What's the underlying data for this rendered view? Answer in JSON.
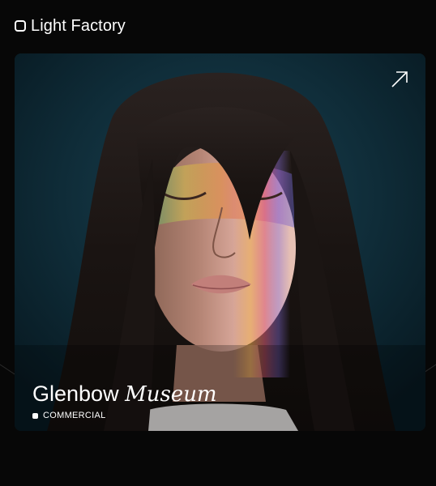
{
  "header": {
    "brand": "Light Factory",
    "logo_icon": "rounded-square-logo-icon"
  },
  "card": {
    "title_part1": "Glenbow",
    "title_part2": "Museum",
    "tag": "COMMERCIAL",
    "open_icon": "arrow-up-right-icon",
    "image_alt": "Portrait of a woman with eyes closed and rainbow light projected across her face"
  },
  "colors": {
    "background": "#070707",
    "card_background": "#0e2a36",
    "text": "#ffffff"
  }
}
